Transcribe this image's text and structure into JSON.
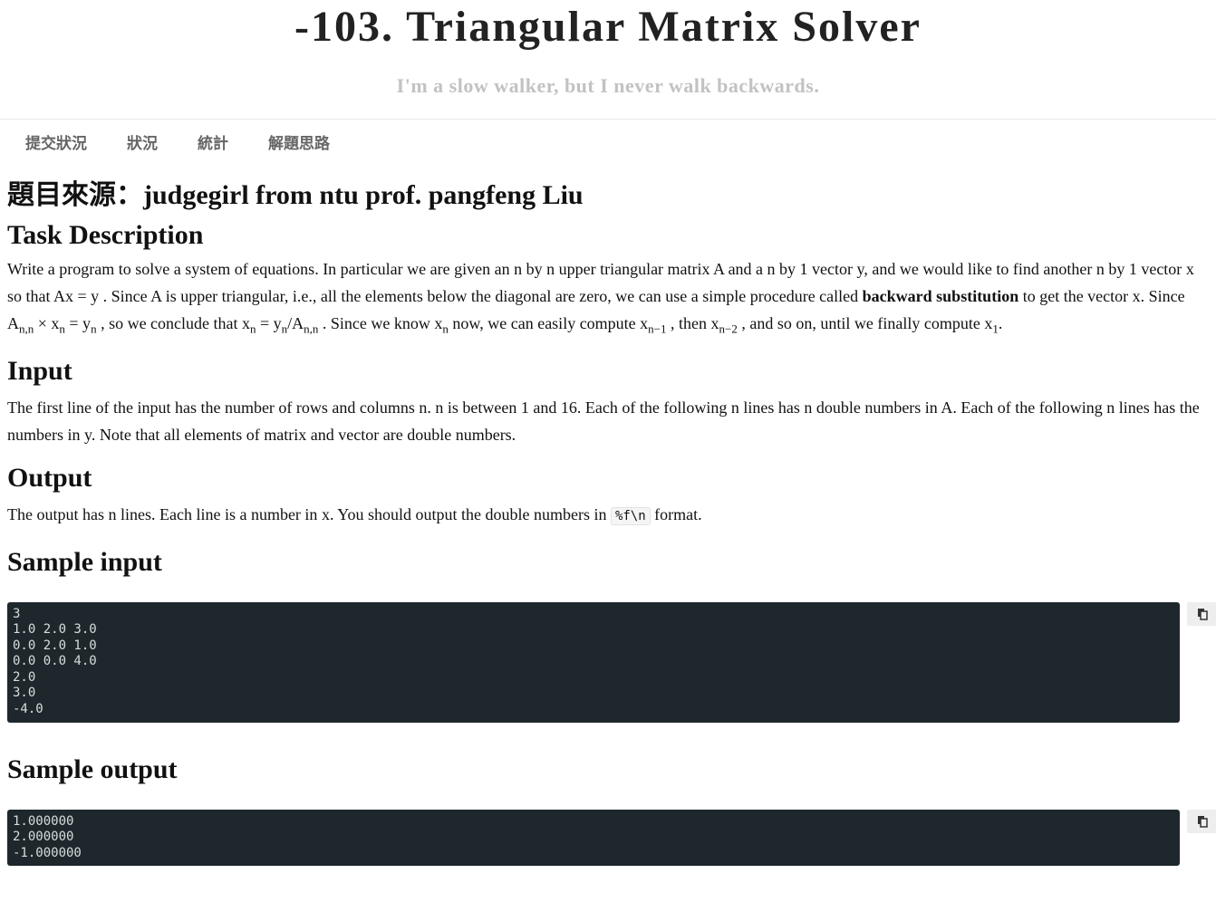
{
  "header": {
    "title": "-103. Triangular Matrix Solver",
    "subtitle": "I'm a slow walker, but I never walk backwards."
  },
  "nav": [
    {
      "label": "提交狀況"
    },
    {
      "label": "狀況"
    },
    {
      "label": "統計"
    },
    {
      "label": "解題思路"
    }
  ],
  "problem": {
    "source_heading": "題目來源：judgegirl from ntu prof. pangfeng Liu",
    "task_heading": "Task Description",
    "input_heading": "Input",
    "output_heading": "Output",
    "sample_input_heading": "Sample input",
    "sample_output_heading": "Sample output",
    "output_format_code": "%f\\n",
    "bold_term": "backward substitution"
  },
  "sample_input": "3\n1.0 2.0 3.0\n0.0 2.0 1.0\n0.0 0.0 4.0\n2.0\n3.0\n-4.0",
  "sample_output": "1.000000\n2.000000\n-1.000000",
  "icons": {
    "copy": "copy-icon"
  }
}
